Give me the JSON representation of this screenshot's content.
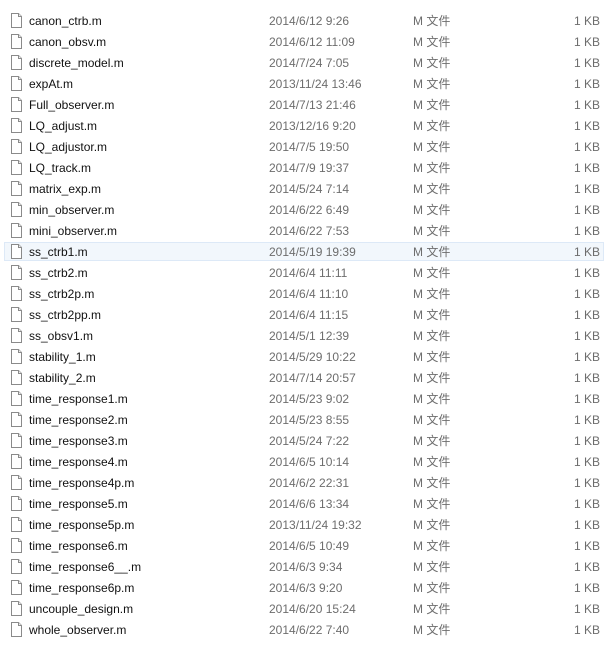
{
  "file_list": {
    "selected_index": 11,
    "files": [
      {
        "name": "canon_ctrb.m",
        "modified": "2014/6/12 9:26",
        "type": "M 文件",
        "size": "1 KB"
      },
      {
        "name": "canon_obsv.m",
        "modified": "2014/6/12 11:09",
        "type": "M 文件",
        "size": "1 KB"
      },
      {
        "name": "discrete_model.m",
        "modified": "2014/7/24 7:05",
        "type": "M 文件",
        "size": "1 KB"
      },
      {
        "name": "expAt.m",
        "modified": "2013/11/24 13:46",
        "type": "M 文件",
        "size": "1 KB"
      },
      {
        "name": "Full_observer.m",
        "modified": "2014/7/13 21:46",
        "type": "M 文件",
        "size": "1 KB"
      },
      {
        "name": "LQ_adjust.m",
        "modified": "2013/12/16 9:20",
        "type": "M 文件",
        "size": "1 KB"
      },
      {
        "name": "LQ_adjustor.m",
        "modified": "2014/7/5 19:50",
        "type": "M 文件",
        "size": "1 KB"
      },
      {
        "name": "LQ_track.m",
        "modified": "2014/7/9 19:37",
        "type": "M 文件",
        "size": "1 KB"
      },
      {
        "name": "matrix_exp.m",
        "modified": "2014/5/24 7:14",
        "type": "M 文件",
        "size": "1 KB"
      },
      {
        "name": "min_observer.m",
        "modified": "2014/6/22 6:49",
        "type": "M 文件",
        "size": "1 KB"
      },
      {
        "name": "mini_observer.m",
        "modified": "2014/6/22 7:53",
        "type": "M 文件",
        "size": "1 KB"
      },
      {
        "name": "ss_ctrb1.m",
        "modified": "2014/5/19 19:39",
        "type": "M 文件",
        "size": "1 KB"
      },
      {
        "name": "ss_ctrb2.m",
        "modified": "2014/6/4 11:11",
        "type": "M 文件",
        "size": "1 KB"
      },
      {
        "name": "ss_ctrb2p.m",
        "modified": "2014/6/4 11:10",
        "type": "M 文件",
        "size": "1 KB"
      },
      {
        "name": "ss_ctrb2pp.m",
        "modified": "2014/6/4 11:15",
        "type": "M 文件",
        "size": "1 KB"
      },
      {
        "name": "ss_obsv1.m",
        "modified": "2014/5/1 12:39",
        "type": "M 文件",
        "size": "1 KB"
      },
      {
        "name": "stability_1.m",
        "modified": "2014/5/29 10:22",
        "type": "M 文件",
        "size": "1 KB"
      },
      {
        "name": "stability_2.m",
        "modified": "2014/7/14 20:57",
        "type": "M 文件",
        "size": "1 KB"
      },
      {
        "name": "time_response1.m",
        "modified": "2014/5/23 9:02",
        "type": "M 文件",
        "size": "1 KB"
      },
      {
        "name": "time_response2.m",
        "modified": "2014/5/23 8:55",
        "type": "M 文件",
        "size": "1 KB"
      },
      {
        "name": "time_response3.m",
        "modified": "2014/5/24 7:22",
        "type": "M 文件",
        "size": "1 KB"
      },
      {
        "name": "time_response4.m",
        "modified": "2014/6/5 10:14",
        "type": "M 文件",
        "size": "1 KB"
      },
      {
        "name": "time_response4p.m",
        "modified": "2014/6/2 22:31",
        "type": "M 文件",
        "size": "1 KB"
      },
      {
        "name": "time_response5.m",
        "modified": "2014/6/6 13:34",
        "type": "M 文件",
        "size": "1 KB"
      },
      {
        "name": "time_response5p.m",
        "modified": "2013/11/24 19:32",
        "type": "M 文件",
        "size": "1 KB"
      },
      {
        "name": "time_response6.m",
        "modified": "2014/6/5 10:49",
        "type": "M 文件",
        "size": "1 KB"
      },
      {
        "name": "time_response6__.m",
        "modified": "2014/6/3 9:34",
        "type": "M 文件",
        "size": "1 KB"
      },
      {
        "name": "time_response6p.m",
        "modified": "2014/6/3 9:20",
        "type": "M 文件",
        "size": "1 KB"
      },
      {
        "name": "uncouple_design.m",
        "modified": "2014/6/20 15:24",
        "type": "M 文件",
        "size": "1 KB"
      },
      {
        "name": "whole_observer.m",
        "modified": "2014/6/22 7:40",
        "type": "M 文件",
        "size": "1 KB"
      }
    ]
  },
  "colors": {
    "selected_row_bg": "#f2f7fc",
    "selected_row_border": "#dde9f7",
    "secondary_text": "#6d6d6d"
  },
  "icons": {
    "file": "document-icon"
  }
}
